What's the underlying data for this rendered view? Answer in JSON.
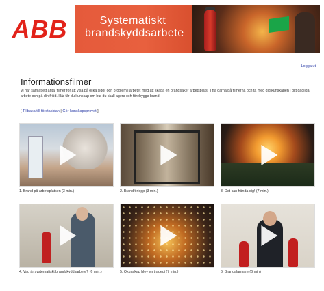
{
  "header": {
    "logo_text": "ABB",
    "banner_title_line1": "Systematiskt",
    "banner_title_line2": "brandskyddsarbete",
    "logout": "Logga ut"
  },
  "main": {
    "title": "Informationsfilmer",
    "intro": "Vi har samlat ett antal filmer för att visa på olika sidor och problem i arbetet med att skapa en brandsäker arbetsplats. Titta gärna på filmerna och ta med dig kunskapen i ditt dagliga arbete och på din fritid. Här får du kunskap om hur du skall agera och förebygga brand.",
    "links": {
      "open": "[ ",
      "back": "Tillbaka till förstasidan",
      "sep": " | ",
      "test": "Gör kunskapsprovet",
      "close": " ]"
    }
  },
  "videos": [
    {
      "caption": "1. Brand på arbetsplatsen (3 min.)"
    },
    {
      "caption": "2. Brandförlopp (3 min.)"
    },
    {
      "caption": "3. Det kan hända dig! (7 min.)"
    },
    {
      "caption": "4. Vad är systematiskt brandskyddsarbete? (6 min.)"
    },
    {
      "caption": "5. Okunskap blev en tragedi (7 min.)"
    },
    {
      "caption": "6. Brandalarmare (6 min)"
    }
  ]
}
